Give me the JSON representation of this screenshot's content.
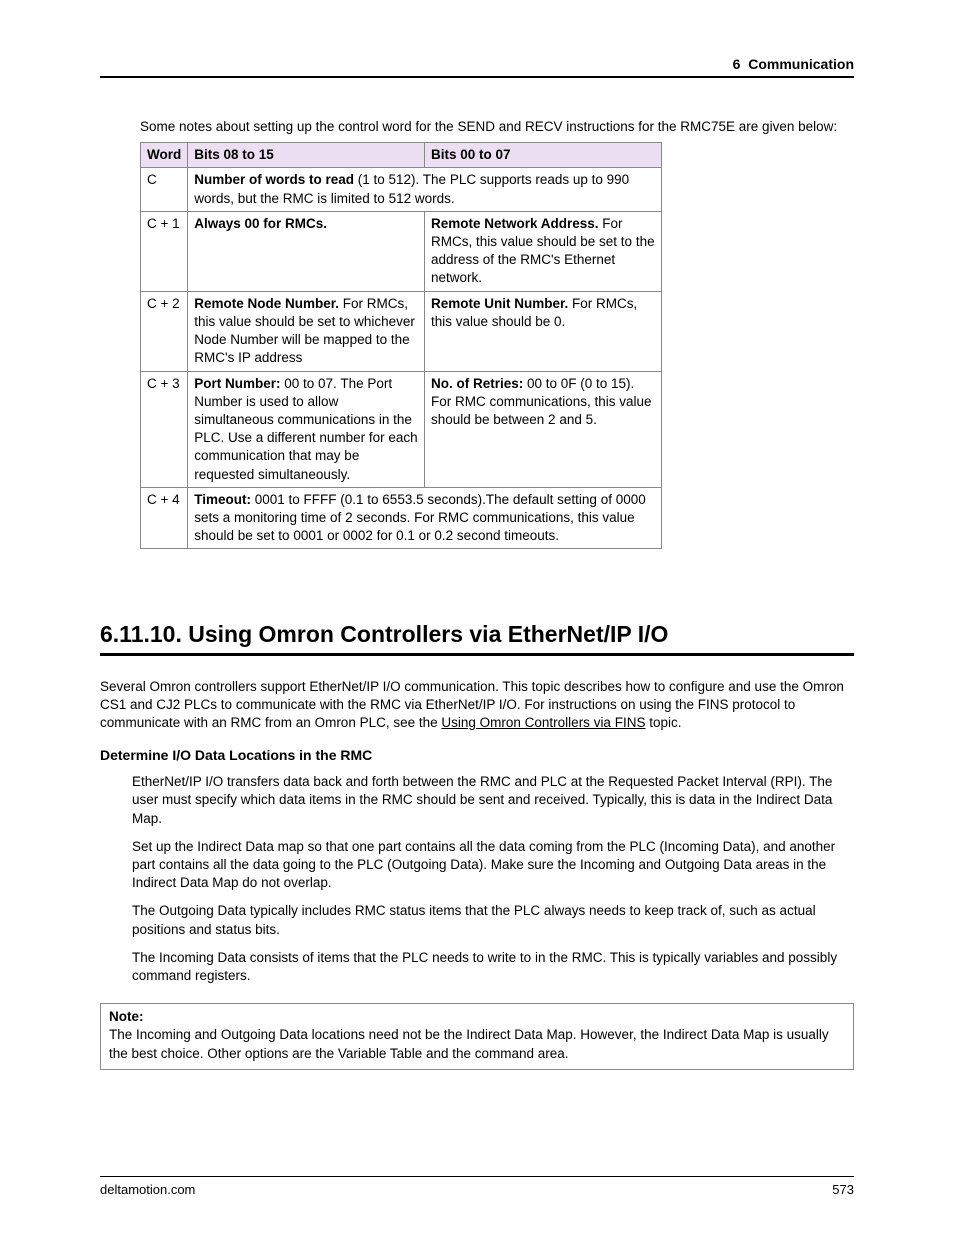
{
  "header": {
    "section": "6",
    "title": "Communication"
  },
  "intro": "Some notes about setting up the control word for the SEND and RECV instructions for the RMC75E are given below:",
  "table": {
    "headers": {
      "word": "Word",
      "bits_hi": "Bits 08 to 15",
      "bits_lo": "Bits 00 to 07"
    },
    "rows": {
      "c": {
        "word": "C",
        "span_bold": "Number of words to read",
        "span_rest": " (1 to 512). The PLC supports reads up to 990 words, but the RMC is limited to 512 words."
      },
      "c1": {
        "word": "C + 1",
        "hi_bold": "Always 00 for RMCs.",
        "lo_bold": "Remote Network Address.",
        "lo_rest": " For RMCs, this value should be set to the address of the RMC's Ethernet network."
      },
      "c2": {
        "word": "C + 2",
        "hi_bold": "Remote Node Number.",
        "hi_rest": " For RMCs, this value should be set to whichever Node Number will be mapped to the RMC's IP address",
        "lo_bold": "Remote Unit Number.",
        "lo_rest": " For RMCs, this value should be 0."
      },
      "c3": {
        "word": "C + 3",
        "hi_bold": "Port Number:",
        "hi_rest": " 00 to 07. The Port Number is used to allow simultaneous communications in the PLC.  Use a different number for each communication that may be requested simultaneously.",
        "lo_bold": "No. of Retries:",
        "lo_rest": " 00 to 0F (0 to 15). For RMC communications, this value should be between 2 and 5."
      },
      "c4": {
        "word": "C + 4",
        "span_bold": "Timeout:",
        "span_rest": " 0001 to FFFF (0.1 to 6553.5 seconds).The default setting of 0000 sets a monitoring time of 2 seconds.  For RMC communications, this value should be set to 0001 or 0002 for 0.1 or 0.2 second timeouts."
      }
    }
  },
  "section": {
    "number": "6.11.10.",
    "title": "Using Omron Controllers via EtherNet/IP I/O",
    "p1a": "Several Omron controllers support EtherNet/IP I/O communication. This topic describes how to configure and use the Omron CS1 and CJ2 PLCs to communicate with the RMC via EtherNet/IP I/O. For instructions on using the FINS protocol to communicate with an RMC from an Omron PLC, see the ",
    "p1link": "Using Omron Controllers via FINS",
    "p1b": " topic.",
    "sub": "Determine I/O Data Locations in the RMC",
    "d1": "EtherNet/IP I/O transfers data back and forth between the RMC and PLC at the Requested Packet Interval (RPI). The user must specify which data items in the RMC should be sent and received. Typically, this is data in the Indirect Data Map.",
    "d2": "Set up the Indirect Data map so that one part contains all the data coming from the PLC (Incoming Data), and another part contains all the data going to the PLC (Outgoing Data). Make sure the Incoming and Outgoing Data areas in the Indirect Data Map do not overlap.",
    "d3": "The Outgoing Data typically includes RMC status items that the PLC always needs to keep track of, such as actual positions and status bits.",
    "d4": "The Incoming Data consists of items that the PLC needs to write to in the RMC. This is typically variables and possibly command registers.",
    "note_label": "Note:",
    "note_body": "The Incoming and Outgoing Data locations need not be the Indirect Data Map. However, the Indirect Data Map is usually the best choice. Other options are the Variable Table and the command area."
  },
  "footer": {
    "site": "deltamotion.com",
    "page": "573"
  }
}
